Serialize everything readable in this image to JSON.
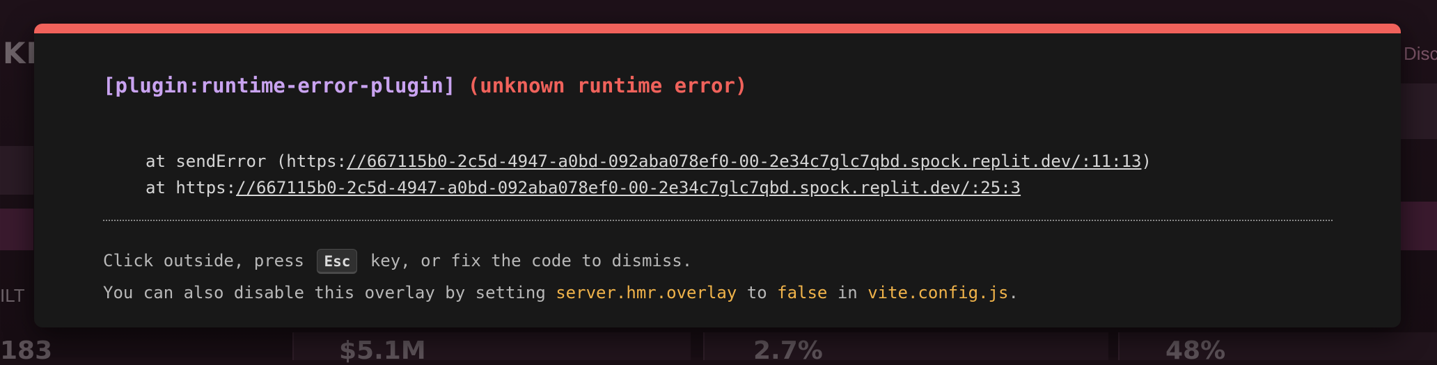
{
  "background": {
    "top_left_fragment": "KI",
    "top_right_fragment": "Disc",
    "side_label": "ILT",
    "stats": [
      "183",
      "$5.1M",
      "2.7%",
      "48%"
    ]
  },
  "overlay": {
    "accent_color": "#f0625b",
    "plugin": "[plugin:runtime-error-plugin]",
    "message": "(unknown runtime error)",
    "stack": [
      {
        "prefix": "at sendError (https:",
        "link": "//667115b0-2c5d-4947-a0bd-092aba078ef0-00-2e34c7glc7qbd.spock.replit.dev/:11:13",
        "suffix": ")"
      },
      {
        "prefix": "at https:",
        "link": "//667115b0-2c5d-4947-a0bd-092aba078ef0-00-2e34c7glc7qbd.spock.replit.dev/:25:3",
        "suffix": ""
      }
    ],
    "tip": {
      "line1_before": "Click outside, press",
      "key": "Esc",
      "line1_after": "key, or fix the code to dismiss.",
      "line2_a": "You can also disable this overlay by setting",
      "setting": "server.hmr.overlay",
      "line2_b": "to",
      "value": "false",
      "line2_c": "in",
      "file": "vite.config.js",
      "line2_end": "."
    }
  }
}
